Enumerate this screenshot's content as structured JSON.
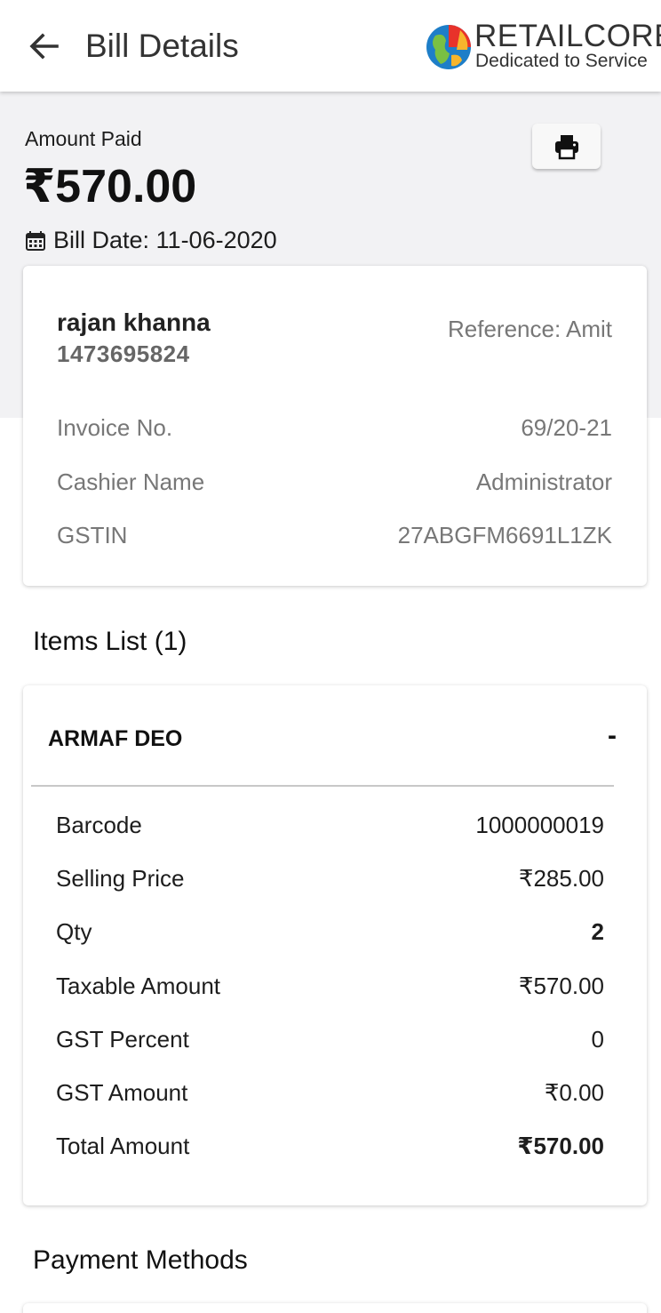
{
  "header": {
    "title": "Bill Details",
    "back_icon": "arrow-left-icon",
    "logo_name": "RETAILCORE",
    "logo_tagline": "Dedicated to Service"
  },
  "summary": {
    "amount_label": "Amount Paid",
    "amount_value": "₹570.00",
    "bill_date": "Bill Date: 11-06-2020",
    "calendar_icon": "calendar-icon",
    "print_icon": "printer-icon"
  },
  "customer": {
    "name": "rajan khanna",
    "phone": "1473695824",
    "reference": "Reference: Amit",
    "rows": [
      {
        "label": "Invoice No.",
        "value": "69/20-21"
      },
      {
        "label": "Cashier Name",
        "value": "Administrator"
      },
      {
        "label": "GSTIN",
        "value": "27ABGFM6691L1ZK"
      }
    ]
  },
  "items": {
    "title": "Items List (1)",
    "list": [
      {
        "name": "ARMAF DEO",
        "toggle": "-",
        "details": [
          {
            "label": "Barcode",
            "value": "1000000019"
          },
          {
            "label": "Selling Price",
            "value": "₹285.00"
          },
          {
            "label": "Qty",
            "value": "2"
          },
          {
            "label": "Taxable Amount",
            "value": "₹570.00"
          },
          {
            "label": "GST Percent",
            "value": "0"
          },
          {
            "label": "GST Amount",
            "value": "₹0.00"
          },
          {
            "label": "Total Amount",
            "value": "₹570.00"
          }
        ]
      }
    ]
  },
  "payment": {
    "title": "Payment Methods"
  },
  "colors": {
    "summary_background": "#f2f2f4",
    "muted_text": "#777777"
  }
}
